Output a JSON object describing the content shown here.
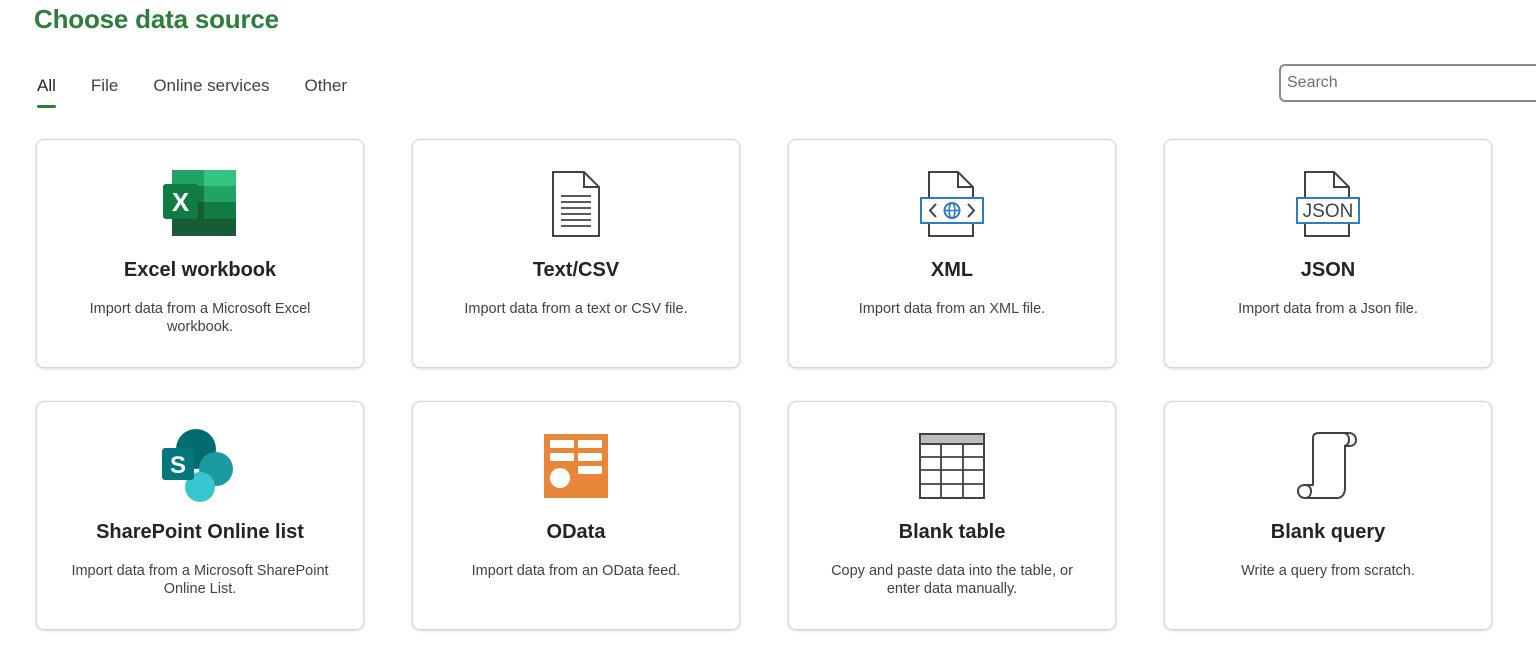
{
  "header": {
    "title": "Choose data source"
  },
  "tabs": [
    {
      "label": "All",
      "active": true
    },
    {
      "label": "File",
      "active": false
    },
    {
      "label": "Online services",
      "active": false
    },
    {
      "label": "Other",
      "active": false
    }
  ],
  "search": {
    "placeholder": "Search",
    "value": ""
  },
  "cards": [
    {
      "title": "Excel workbook",
      "description": "Import data from a Microsoft Excel workbook.",
      "icon": "excel-icon"
    },
    {
      "title": "Text/CSV",
      "description": "Import data from a text or CSV file.",
      "icon": "text-file-icon"
    },
    {
      "title": "XML",
      "description": "Import data from an XML file.",
      "icon": "xml-file-icon"
    },
    {
      "title": "JSON",
      "description": "Import data from a Json file.",
      "icon": "json-file-icon",
      "icon_text": "JSON"
    },
    {
      "title": "SharePoint Online list",
      "description": "Import data from a Microsoft SharePoint Online List.",
      "icon": "sharepoint-icon"
    },
    {
      "title": "OData",
      "description": "Import data from an OData feed.",
      "icon": "odata-icon"
    },
    {
      "title": "Blank table",
      "description": "Copy and paste data into the table, or enter data manually.",
      "icon": "blank-table-icon"
    },
    {
      "title": "Blank query",
      "description": "Write a query from scratch.",
      "icon": "blank-query-icon"
    }
  ],
  "colors": {
    "accent": "#2e7d3c",
    "excel_green": "#1f7244",
    "xml_blue": "#2f7cc0",
    "odata_orange": "#e8863a",
    "sharepoint_teal": "#03787c"
  }
}
